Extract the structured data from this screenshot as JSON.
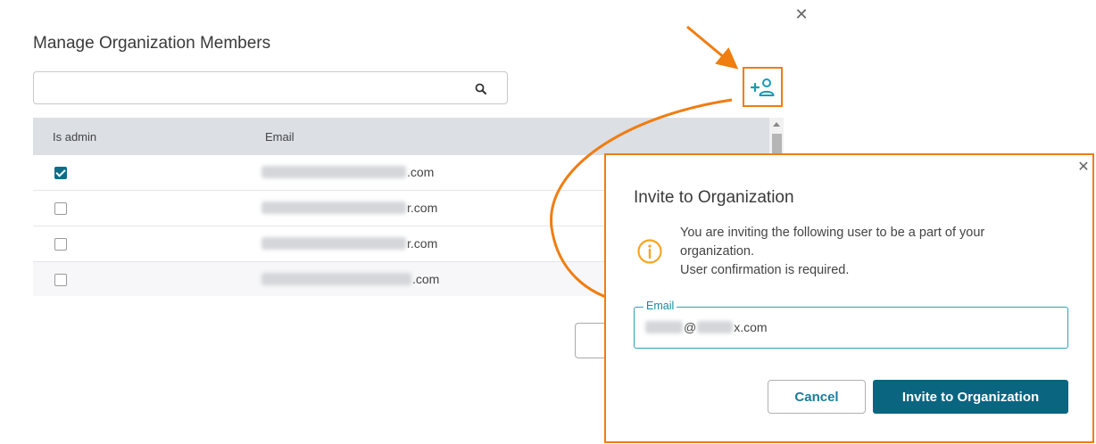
{
  "main": {
    "title": "Manage Organization Members",
    "search": {
      "value": "",
      "placeholder": ""
    },
    "table": {
      "columns": [
        "Is admin",
        "Email"
      ],
      "rows": [
        {
          "is_admin": true,
          "email_suffix": ".com"
        },
        {
          "is_admin": false,
          "email_suffix": "r.com"
        },
        {
          "is_admin": false,
          "email_suffix": "r.com"
        },
        {
          "is_admin": false,
          "email_suffix": ".com"
        }
      ]
    },
    "icons": {
      "close": "close-icon",
      "search": "search-icon",
      "add_user": "add-user-icon"
    }
  },
  "invite_dialog": {
    "title": "Invite to Organization",
    "info_line1": "You are inviting the following user to be a part of your",
    "info_line2": "organization.",
    "info_line3": "User confirmation is required.",
    "email_label": "Email",
    "email_at": "@",
    "email_suffix": "x.com",
    "cancel_label": "Cancel",
    "invite_label": "Invite to Organization",
    "icons": {
      "info": "info-icon",
      "close": "close-icon"
    }
  },
  "colors": {
    "accent": "#0a6580",
    "annotation": "#f07d10",
    "teal_icon": "#1a9ab3",
    "info": "#f5a623"
  }
}
